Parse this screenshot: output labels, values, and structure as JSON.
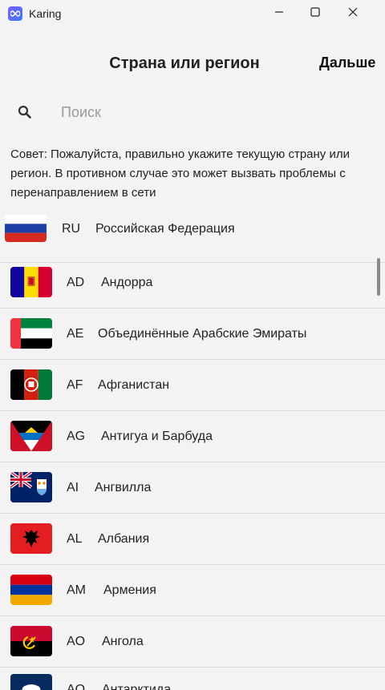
{
  "window": {
    "title": "Karing",
    "icons": {
      "minimize": "minimize-icon",
      "maximize": "maximize-icon",
      "close": "close-icon"
    }
  },
  "header": {
    "title": "Страна или регион",
    "next_label": "Дальше"
  },
  "search": {
    "placeholder": "Поиск",
    "value": ""
  },
  "hint": "Совет: Пожалуйста, правильно укажите текущую страну или регион. В противном случае это может вызвать проблемы с перенаправлением в сети",
  "selected": {
    "code": "RU",
    "name": "Российская Федерация",
    "flag": "flag-ru"
  },
  "countries": [
    {
      "code": "AD",
      "name": "Андорра",
      "flag": "flag-ad"
    },
    {
      "code": "AE",
      "name": "Объединённые Арабские Эмираты",
      "flag": "flag-ae"
    },
    {
      "code": "AF",
      "name": "Афганистан",
      "flag": "flag-af"
    },
    {
      "code": "AG",
      "name": "Антигуа и Барбуда",
      "flag": "flag-ag"
    },
    {
      "code": "AI",
      "name": "Ангвилла",
      "flag": "flag-ai"
    },
    {
      "code": "AL",
      "name": "Албания",
      "flag": "flag-al"
    },
    {
      "code": "AM",
      "name": "Армения",
      "flag": "flag-am"
    },
    {
      "code": "AO",
      "name": "Ангола",
      "flag": "flag-ao"
    },
    {
      "code": "AQ",
      "name": "Антарктида",
      "flag": "flag-aq"
    }
  ]
}
